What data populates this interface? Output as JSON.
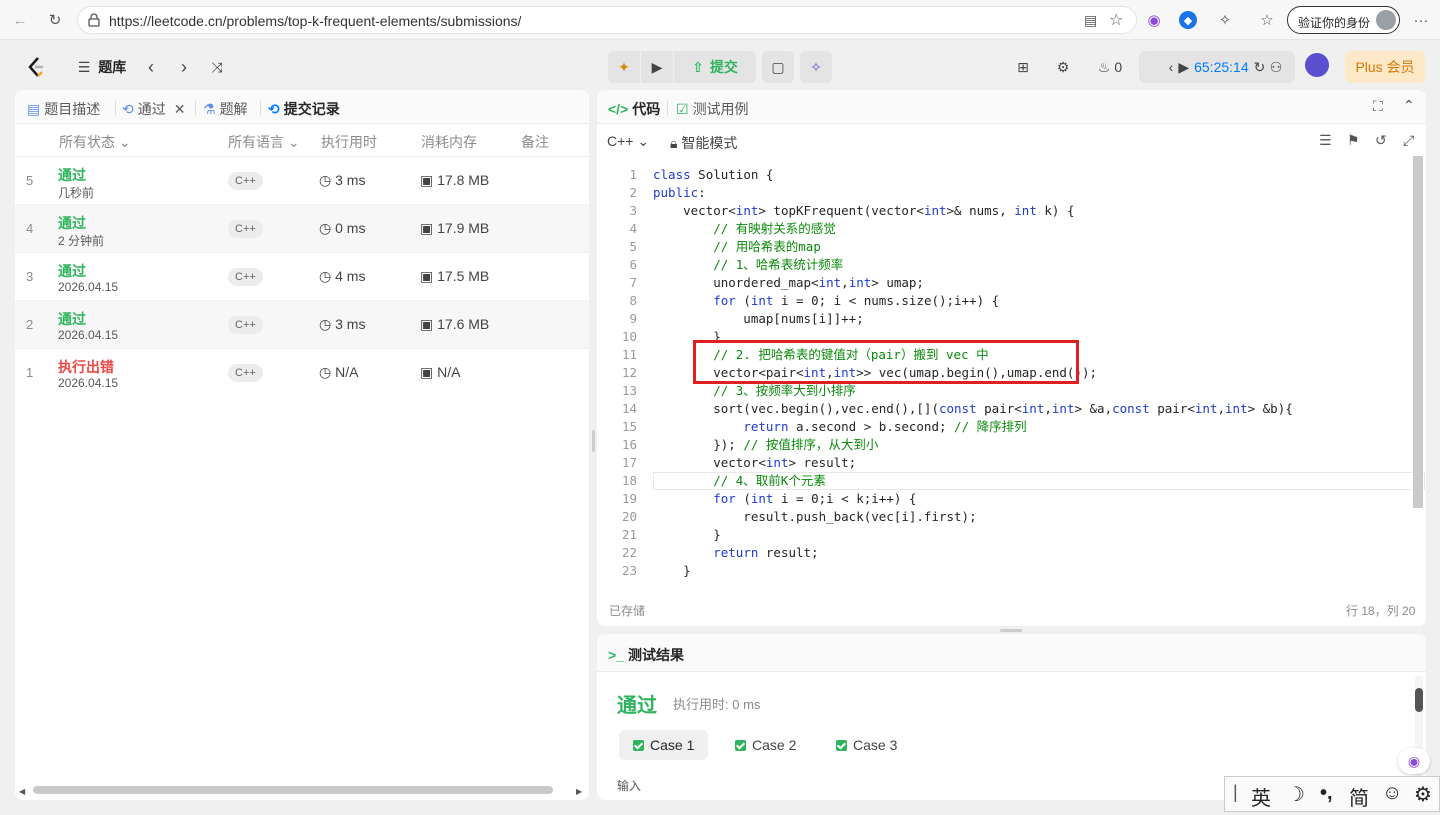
{
  "browser": {
    "url": "https://leetcode.cn/problems/top-k-frequent-elements/submissions/",
    "verify_label": "验证你的身份",
    "menu_label": "···"
  },
  "header": {
    "problem_bank_label": "题库",
    "submit_label": "提交",
    "streak_count": "0",
    "timer": "65:25:14",
    "plus_label": "Plus 会员"
  },
  "left_panel": {
    "tabs": [
      {
        "label": "题目描述"
      },
      {
        "label": "通过"
      },
      {
        "label": "题解"
      },
      {
        "label": "提交记录"
      }
    ],
    "columns": [
      "所有状态",
      "所有语言",
      "执行用时",
      "消耗内存",
      "备注"
    ],
    "submissions": [
      {
        "index": "5",
        "status": "通过",
        "time": "几秒前",
        "lang": "C++",
        "runtime": "3 ms",
        "memory": "17.8 MB",
        "error": false
      },
      {
        "index": "4",
        "status": "通过",
        "time": "2 分钟前",
        "lang": "C++",
        "runtime": "0 ms",
        "memory": "17.9 MB",
        "error": false
      },
      {
        "index": "3",
        "status": "通过",
        "time": "2026.04.15",
        "lang": "C++",
        "runtime": "4 ms",
        "memory": "17.5 MB",
        "error": false
      },
      {
        "index": "2",
        "status": "通过",
        "time": "2026.04.15",
        "lang": "C++",
        "runtime": "3 ms",
        "memory": "17.6 MB",
        "error": false
      },
      {
        "index": "1",
        "status": "执行出错",
        "time": "2026.04.15",
        "lang": "C++",
        "runtime": "N/A",
        "memory": "N/A",
        "error": true
      }
    ]
  },
  "editor": {
    "tab_code": "代码",
    "tab_testcase": "测试用例",
    "language": "C++",
    "mode": "智能模式",
    "saved_status": "已存储",
    "cursor_pos": "行 18，列 20",
    "lines": [
      "class Solution {",
      "public:",
      "    vector<int> topKFrequent(vector<int>& nums, int k) {",
      "        // 有映射关系的感觉",
      "        // 用哈希表的map",
      "        // 1、哈希表统计频率",
      "        unordered_map<int,int> umap;",
      "        for (int i = 0; i < nums.size();i++) {",
      "            umap[nums[i]]++;",
      "        }",
      "        // 2. 把哈希表的键值对（pair）搬到 vec 中",
      "        vector<pair<int,int>> vec(umap.begin(),umap.end());",
      "        // 3、按频率大到小排序",
      "        sort(vec.begin(),vec.end(),[](const pair<int,int> &a,const pair<int,int> &b){",
      "            return a.second > b.second; // 降序排列",
      "        }); // 按值排序，从大到小",
      "        vector<int> result;",
      "        // 4、取前K个元素",
      "        for (int i = 0;i < k;i++) {",
      "            result.push_back(vec[i].first);",
      "        }",
      "        return result;",
      "    }"
    ]
  },
  "result": {
    "title": "测试结果",
    "status": "通过",
    "runtime_label": "执行用时: 0 ms",
    "cases": [
      "Case 1",
      "Case 2",
      "Case 3"
    ],
    "input_label": "输入"
  },
  "ime": {
    "lang": "英",
    "moon": "☽",
    "punct": "•,",
    "script": "简",
    "emoji": "☺",
    "settings": "⚙"
  },
  "colors": {
    "accepted": "#2db55d",
    "error": "#ef4743",
    "highlight_box": "#e02020",
    "plus_bg": "#fde9c8"
  }
}
